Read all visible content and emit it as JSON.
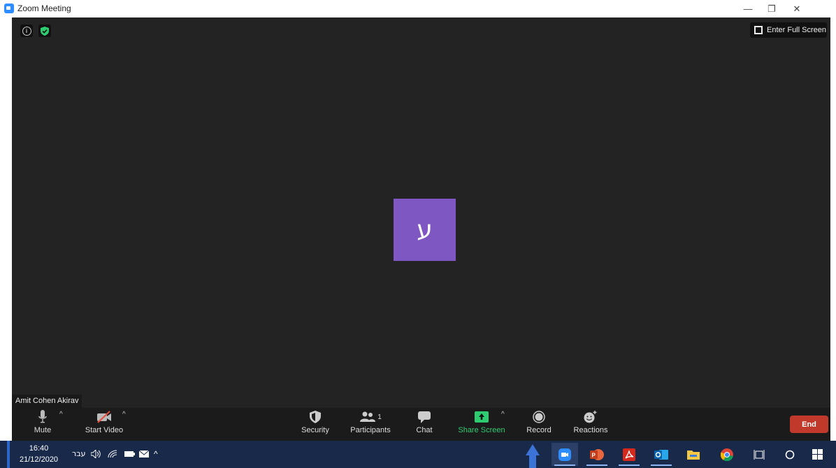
{
  "window": {
    "title": "Zoom Meeting",
    "minimize_glyph": "—",
    "restore_glyph": "❐",
    "close_glyph": "✕"
  },
  "meeting": {
    "fullscreen_label": "Enter Full Screen",
    "avatar_initial": "ע",
    "avatar_color": "#7E57C2",
    "participant_name": "Amit Cohen Akirav",
    "info_glyph": "i"
  },
  "toolbar": {
    "mute_label": "Mute",
    "start_video_label": "Start Video",
    "security_label": "Security",
    "participants_label": "Participants",
    "participants_count": "1",
    "chat_label": "Chat",
    "share_screen_label": "Share Screen",
    "record_label": "Record",
    "reactions_label": "Reactions",
    "end_label": "End",
    "caret_glyph": "^",
    "share_color": "#2ECC71",
    "end_color": "#C0392B"
  },
  "taskbar": {
    "time": "16:40",
    "date": "21/12/2020",
    "language": "עבר",
    "tray_chevron": "^",
    "icons": [
      "volume-icon",
      "wifi-icon",
      "battery-icon",
      "mail-icon",
      "chevron-up-icon"
    ],
    "apps": [
      "zoom-icon",
      "powerpoint-icon",
      "acrobat-icon",
      "outlook-icon",
      "file-explorer-icon",
      "chrome-icon",
      "task-view-icon",
      "cortana-icon",
      "windows-start-icon"
    ]
  }
}
